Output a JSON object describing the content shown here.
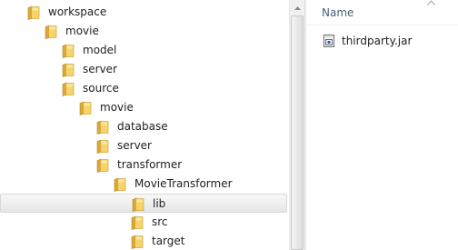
{
  "tree": {
    "items": [
      {
        "label": "workspace",
        "depth": 0,
        "selected": false
      },
      {
        "label": "movie",
        "depth": 1,
        "selected": false
      },
      {
        "label": "model",
        "depth": 2,
        "selected": false
      },
      {
        "label": "server",
        "depth": 2,
        "selected": false
      },
      {
        "label": "source",
        "depth": 2,
        "selected": false
      },
      {
        "label": "movie",
        "depth": 3,
        "selected": false
      },
      {
        "label": "database",
        "depth": 4,
        "selected": false
      },
      {
        "label": "server",
        "depth": 4,
        "selected": false
      },
      {
        "label": "transformer",
        "depth": 4,
        "selected": false
      },
      {
        "label": "MovieTransformer",
        "depth": 5,
        "selected": false
      },
      {
        "label": "lib",
        "depth": 6,
        "selected": true
      },
      {
        "label": "src",
        "depth": 6,
        "selected": false
      },
      {
        "label": "target",
        "depth": 6,
        "selected": false
      }
    ]
  },
  "file_list": {
    "column_header": "Name",
    "files": [
      {
        "name": "thirdparty.jar",
        "icon": "jar-file-icon"
      }
    ]
  },
  "icons": {
    "folder": "folder-icon",
    "scroll_up": "scroll-up-arrow-icon",
    "sort": "sort-ascending-icon"
  },
  "colors": {
    "folder_yellow": "#f2cd5c",
    "selection_background": "#e8e8e8",
    "header_text": "#4c607a"
  }
}
